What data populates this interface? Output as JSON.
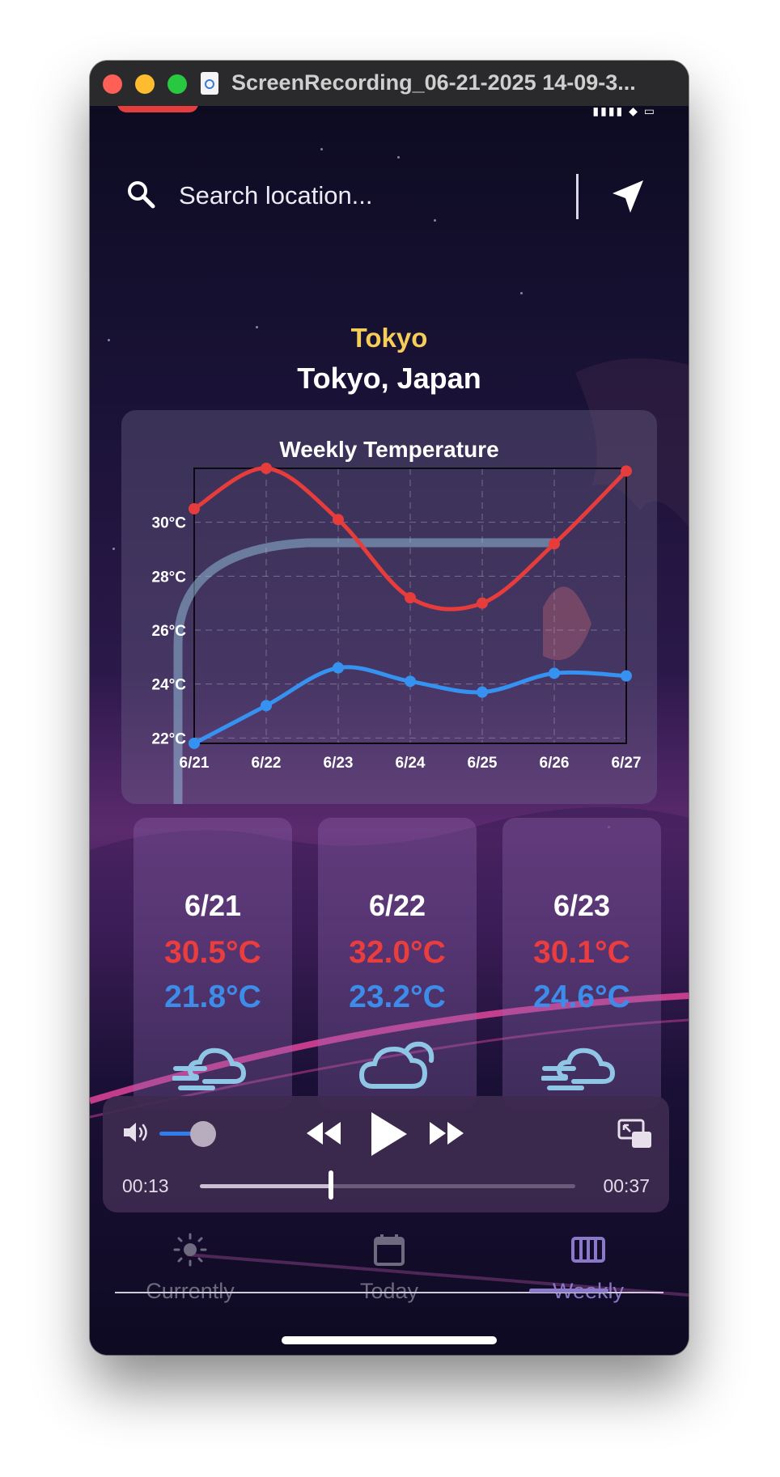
{
  "window": {
    "title": "ScreenRecording_06-21-2025 14-09-3..."
  },
  "search": {
    "placeholder": "Search location..."
  },
  "location": {
    "short_name": "Tokyo",
    "full_name": "Tokyo, Japan"
  },
  "chart_data": {
    "type": "line",
    "title": "Weekly Temperature",
    "categories": [
      "6/21",
      "6/22",
      "6/23",
      "6/24",
      "6/25",
      "6/26",
      "6/27"
    ],
    "y_tick_labels": [
      "22°C",
      "24°C",
      "26°C",
      "28°C",
      "30°C"
    ],
    "y_ticks": [
      22,
      24,
      26,
      28,
      30
    ],
    "ylim": [
      21.8,
      32.0
    ],
    "grid": true,
    "series": [
      {
        "color": "#e63c3c",
        "values": [
          30.5,
          32.0,
          30.1,
          27.2,
          27.0,
          29.2,
          31.9
        ]
      },
      {
        "color": "#3592f0",
        "values": [
          21.8,
          23.2,
          24.6,
          24.1,
          23.7,
          24.4,
          24.3
        ]
      }
    ]
  },
  "daily": [
    {
      "date": "6/21",
      "high": "30.5°C",
      "low": "21.8°C",
      "icon": "wind-cloud-icon"
    },
    {
      "date": "6/22",
      "high": "32.0°C",
      "low": "23.2°C",
      "icon": "cloud-icon"
    },
    {
      "date": "6/23",
      "high": "30.1°C",
      "low": "24.6°C",
      "icon": "wind-cloud-icon"
    }
  ],
  "player": {
    "current_time": "00:13",
    "total_time": "00:37",
    "progress": 0.35,
    "volume": 0.7
  },
  "tabs": [
    {
      "label": "Currently",
      "icon": "sun-icon"
    },
    {
      "label": "Today",
      "icon": "calendar-icon"
    },
    {
      "label": "Weekly",
      "icon": "week-grid-icon",
      "active": true
    }
  ]
}
